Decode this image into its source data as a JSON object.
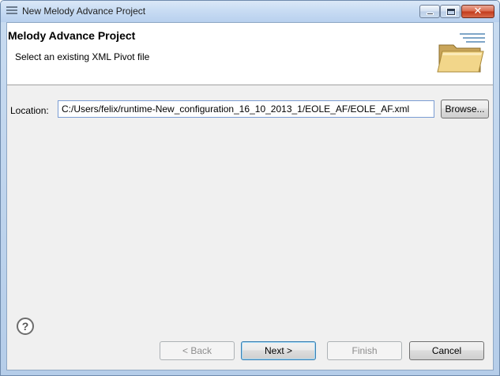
{
  "window": {
    "title": "New Melody Advance Project",
    "close_glyph": "✕"
  },
  "banner": {
    "title": "Melody Advance Project",
    "message": "Select an existing XML Pivot file",
    "icon": "folder-icon"
  },
  "location": {
    "label": "Location:",
    "value": "C:/Users/felix/runtime-New_configuration_16_10_2013_1/EOLE_AF/EOLE_AF.xml",
    "browse_label": "Browse..."
  },
  "buttons": {
    "help": "?",
    "back": "< Back",
    "next": "Next >",
    "finish": "Finish",
    "cancel": "Cancel"
  },
  "colors": {
    "titlebar": "#c7dbf3",
    "close": "#c2391a",
    "dialog_bg": "#f0f0f0"
  }
}
